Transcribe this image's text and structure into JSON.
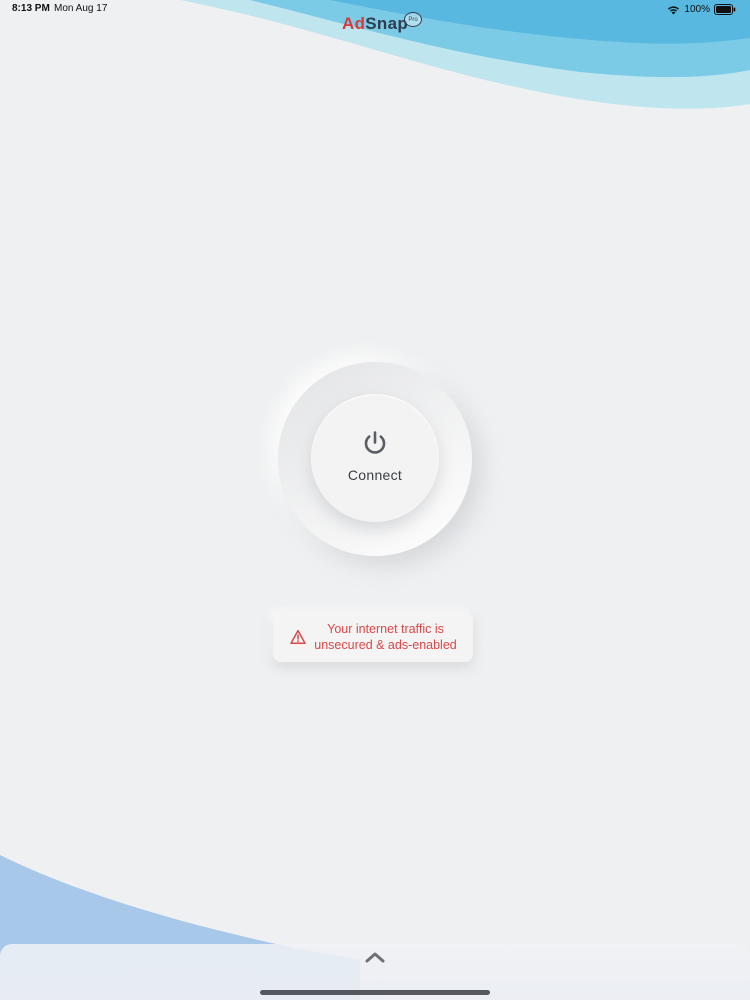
{
  "status_bar": {
    "time": "8:13 PM",
    "date": "Mon Aug 17",
    "battery": "100%",
    "icons": [
      "wifi-icon",
      "battery-icon"
    ]
  },
  "app": {
    "logo_part1": "Ad",
    "logo_part2": "Snap",
    "logo_badge": "Pro",
    "colors": {
      "accent_red": "#d93a3a",
      "wave_blue": "#58b8df",
      "wave_light": "#bfe6ef",
      "text_dark": "#2f3c4e"
    }
  },
  "connect": {
    "label": "Connect",
    "icon": "power-icon"
  },
  "warning": {
    "icon": "warning-triangle-icon",
    "text_line1": "Your internet traffic is",
    "text_line2": "unsecured & ads-enabled"
  },
  "bottom_panel": {
    "icon": "chevron-up-icon"
  }
}
